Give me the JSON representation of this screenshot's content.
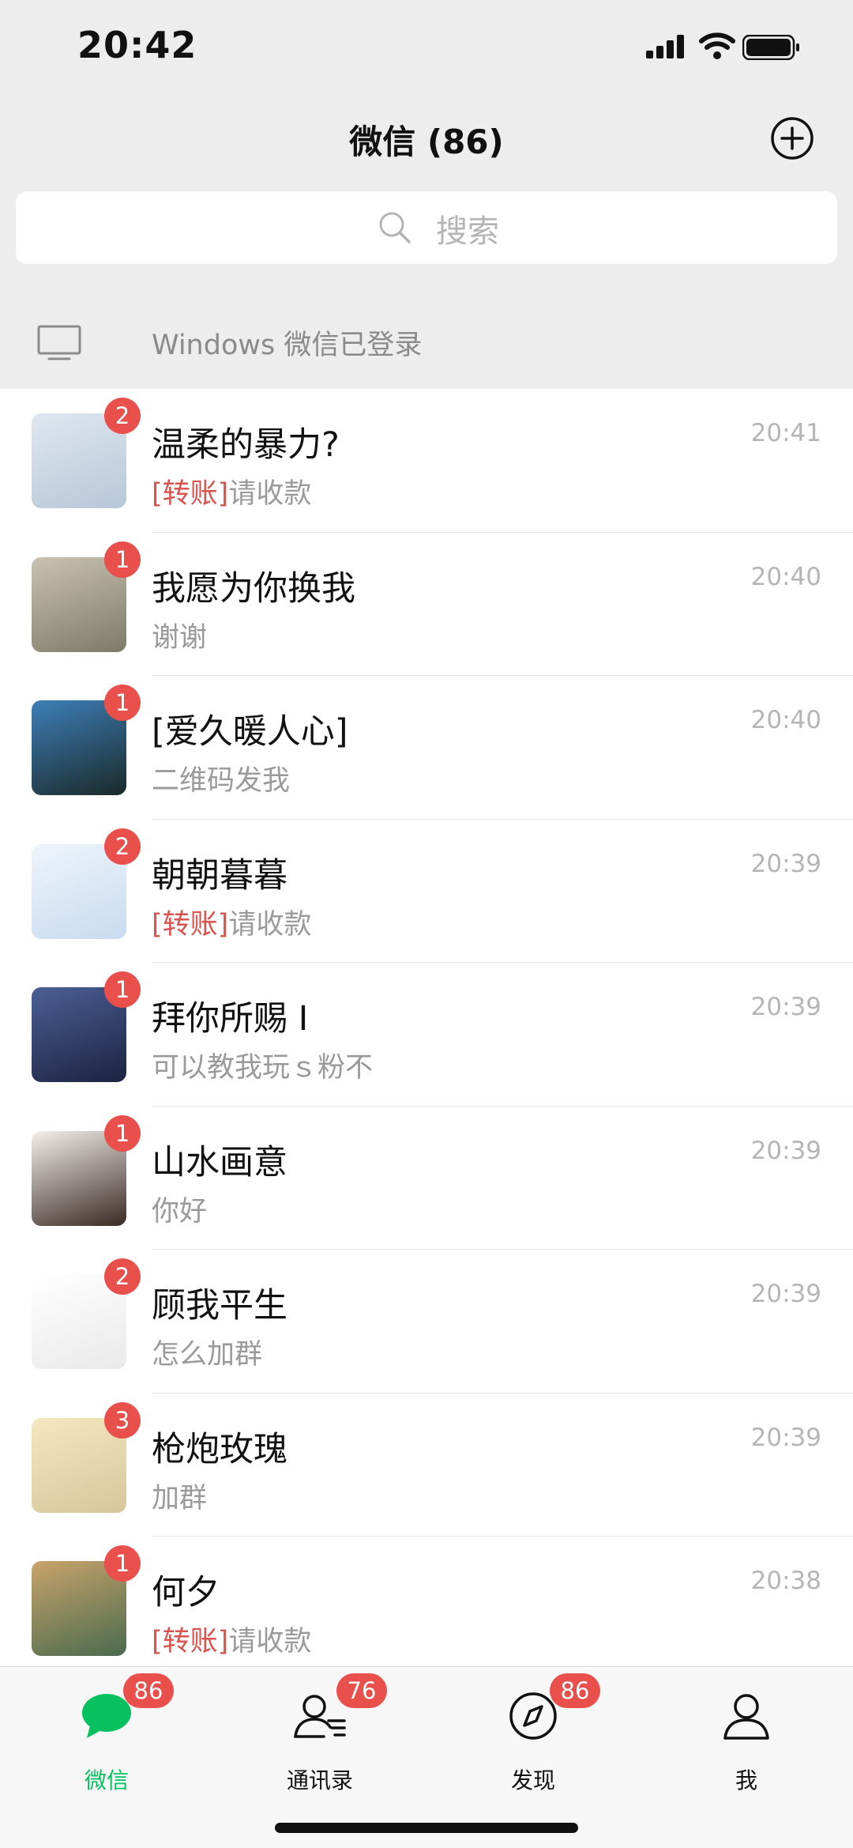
{
  "status_bar": {
    "time": "20:42"
  },
  "header": {
    "title": "微信 (86)"
  },
  "search": {
    "placeholder": "搜索"
  },
  "pc_login": {
    "text": "Windows 微信已登录"
  },
  "chats": [
    {
      "name": "温柔的暴力?",
      "tag": "[转账]",
      "message": "请收款",
      "time": "20:41",
      "unread": "2",
      "avatar_colors": [
        "#dfe7ef",
        "#b7c7d8"
      ]
    },
    {
      "name": "我愿为你换我",
      "tag": "",
      "message": "谢谢",
      "time": "20:40",
      "unread": "1",
      "avatar_colors": [
        "#c9c2b2",
        "#7f7a67"
      ]
    },
    {
      "name": "[爱久暖人心]",
      "tag": "",
      "message": "二维码发我",
      "time": "20:40",
      "unread": "1",
      "avatar_colors": [
        "#3d7fb8",
        "#1a2a2a"
      ]
    },
    {
      "name": "朝朝暮暮",
      "tag": "[转账]",
      "message": "请收款",
      "time": "20:39",
      "unread": "2",
      "avatar_colors": [
        "#eef4fb",
        "#c7dbef"
      ]
    },
    {
      "name": "拜你所赐 I",
      "tag": "",
      "message": "可以教我玩ｓ粉不",
      "time": "20:39",
      "unread": "1",
      "avatar_colors": [
        "#4b5f95",
        "#1b2340"
      ]
    },
    {
      "name": "山水画意",
      "tag": "",
      "message": "你好",
      "time": "20:39",
      "unread": "1",
      "avatar_colors": [
        "#f3efec",
        "#3a2a24"
      ]
    },
    {
      "name": "顾我平生",
      "tag": "",
      "message": "怎么加群",
      "time": "20:39",
      "unread": "2",
      "avatar_colors": [
        "#ffffff",
        "#e9e9e9"
      ]
    },
    {
      "name": "枪炮玫瑰",
      "tag": "",
      "message": "加群",
      "time": "20:39",
      "unread": "3",
      "avatar_colors": [
        "#f4e6bf",
        "#d8c79a"
      ]
    },
    {
      "name": "何夕",
      "tag": "[转账]",
      "message": "请收款",
      "time": "20:38",
      "unread": "1",
      "avatar_colors": [
        "#c8a36a",
        "#4a6b4e"
      ]
    }
  ],
  "tabbar": {
    "chats": {
      "label": "微信",
      "badge": "86",
      "icon": "chat-bubble-icon"
    },
    "contacts": {
      "label": "通讯录",
      "badge": "76",
      "icon": "contacts-icon"
    },
    "discover": {
      "label": "发现",
      "badge": "86",
      "icon": "compass-icon"
    },
    "me": {
      "label": "我",
      "badge": "",
      "icon": "person-icon"
    }
  },
  "colors": {
    "accent": "#07c160",
    "badge": "#e94f4b",
    "transfer_tag": "#d9534f"
  }
}
